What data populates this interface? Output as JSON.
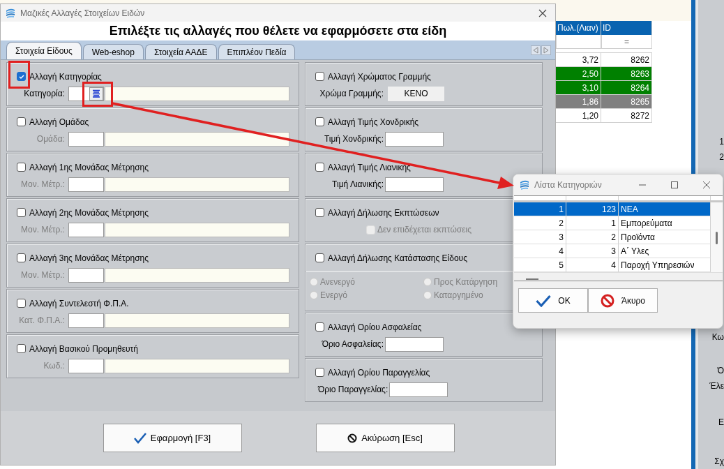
{
  "background_app": {
    "columns": [
      "Πωλ.(Λιαν)",
      "ID"
    ],
    "id_filter": "=",
    "rows": [
      {
        "price": "3,72",
        "id": "8262",
        "color": "#ffffff"
      },
      {
        "price": "2,50",
        "id": "8263",
        "color": "#008000"
      },
      {
        "price": "3,10",
        "id": "8264",
        "color": "#008000"
      },
      {
        "price": "1,86",
        "id": "8265",
        "color": "#808080"
      },
      {
        "price": "1,20",
        "id": "8272",
        "color": "#ffffff"
      }
    ],
    "side_labels": [
      "1",
      "2",
      "Κω",
      "Ό",
      "Έλε",
      "Ε",
      "Σχ"
    ]
  },
  "window": {
    "title": "Μαζικές Αλλαγές Στοιχείων Ειδών"
  },
  "heading": "Επιλέξτε τις αλλαγές που θέλετε να εφαρμόσετε στα είδη",
  "tabs": [
    {
      "label": "Στοιχεία Είδους",
      "selected": true
    },
    {
      "label": "Web-eshop",
      "selected": false
    },
    {
      "label": "Στοιχεία ΑΑΔΕ",
      "selected": false
    },
    {
      "label": "Επιπλέον Πεδία",
      "selected": false
    }
  ],
  "left_groups": [
    {
      "kind": "lookup",
      "label": "Αλλαγή Κατηγορίας",
      "checked": true,
      "field_label": "Κατηγορία:",
      "disabled": false
    },
    {
      "kind": "code",
      "label": "Αλλαγή Ομάδας",
      "checked": false,
      "field_label": "Ομάδα:",
      "disabled": true
    },
    {
      "kind": "code",
      "label": "Αλλαγή 1ης Μονάδας Μέτρησης",
      "checked": false,
      "field_label": "Μον. Μέτρ.:",
      "disabled": true
    },
    {
      "kind": "code",
      "label": "Αλλαγή 2ης Μονάδας Μέτρησης",
      "checked": false,
      "field_label": "Μον. Μέτρ.:",
      "disabled": true
    },
    {
      "kind": "code",
      "label": "Αλλαγή 3ης Μονάδας Μέτρησης",
      "checked": false,
      "field_label": "Μον. Μέτρ.:",
      "disabled": true
    },
    {
      "kind": "code",
      "label": "Αλλαγή Συντελεστή Φ.Π.Α.",
      "checked": false,
      "field_label": "Κατ. Φ.Π.Α.:",
      "disabled": true
    },
    {
      "kind": "code",
      "label": "Αλλαγή Βασικού Προμηθευτή",
      "checked": false,
      "field_label": "Κωδ.:",
      "disabled": true
    }
  ],
  "right_groups": [
    {
      "kind": "color",
      "label": "Αλλαγή Χρώματος Γραμμής",
      "checked": false,
      "field_label": "Χρώμα Γραμμής:",
      "value": "ΚΕΝΟ"
    },
    {
      "kind": "value",
      "label": "Αλλαγή Τιμής Χονδρικής",
      "checked": false,
      "field_label": "Τιμή Χονδρικής:"
    },
    {
      "kind": "value",
      "label": "Αλλαγή Τιμής Λιανικής",
      "checked": false,
      "field_label": "Τιμή Λιανικής:"
    },
    {
      "kind": "option",
      "label": "Αλλαγή Δήλωσης Εκπτώσεων",
      "checked": false,
      "option": {
        "label": "Δεν επιδέχεται εκπτώσεις",
        "checked": false,
        "disabled": true
      }
    },
    {
      "kind": "status",
      "label": "Αλλαγή Δήλωσης Κατάστασης Είδους",
      "checked": false,
      "radios_disabled": true,
      "radios": [
        {
          "label": "Ανενεργό",
          "selected": false
        },
        {
          "label": "Προς Κατάργηση",
          "selected": false
        },
        {
          "label": "Ενεργό",
          "selected": false
        },
        {
          "label": "Καταργημένο",
          "selected": false
        }
      ]
    },
    {
      "kind": "value",
      "label": "Αλλαγή Ορίου Ασφαλείας",
      "checked": false,
      "field_label": "Όριο Ασφαλείας:"
    },
    {
      "kind": "value",
      "label": "Αλλαγή Ορίου Παραγγελίας",
      "checked": false,
      "field_label": "Όριο Παραγγελίας:"
    }
  ],
  "buttons": [
    {
      "kind": "apply",
      "label": "Εφαρμογή [F3]"
    },
    {
      "kind": "cancel",
      "label": "Ακύρωση [Esc]"
    }
  ],
  "popup": {
    "title": "Λίστα Κατηγοριών",
    "rows": [
      {
        "cells": [
          "1",
          "123",
          "ΝΕΑ"
        ],
        "selected": true
      },
      {
        "cells": [
          "2",
          "1",
          "Εμπορεύματα"
        ],
        "selected": false
      },
      {
        "cells": [
          "3",
          "2",
          "Προϊόντα"
        ],
        "selected": false
      },
      {
        "cells": [
          "4",
          "3",
          "Α΄ Υλες"
        ],
        "selected": false
      },
      {
        "cells": [
          "5",
          "4",
          "Παροχή Υπηρεσιών"
        ],
        "selected": false
      }
    ],
    "buttons": [
      {
        "kind": "ok",
        "label": "OK"
      },
      {
        "kind": "cancel",
        "label": "Άκυρο"
      }
    ]
  }
}
